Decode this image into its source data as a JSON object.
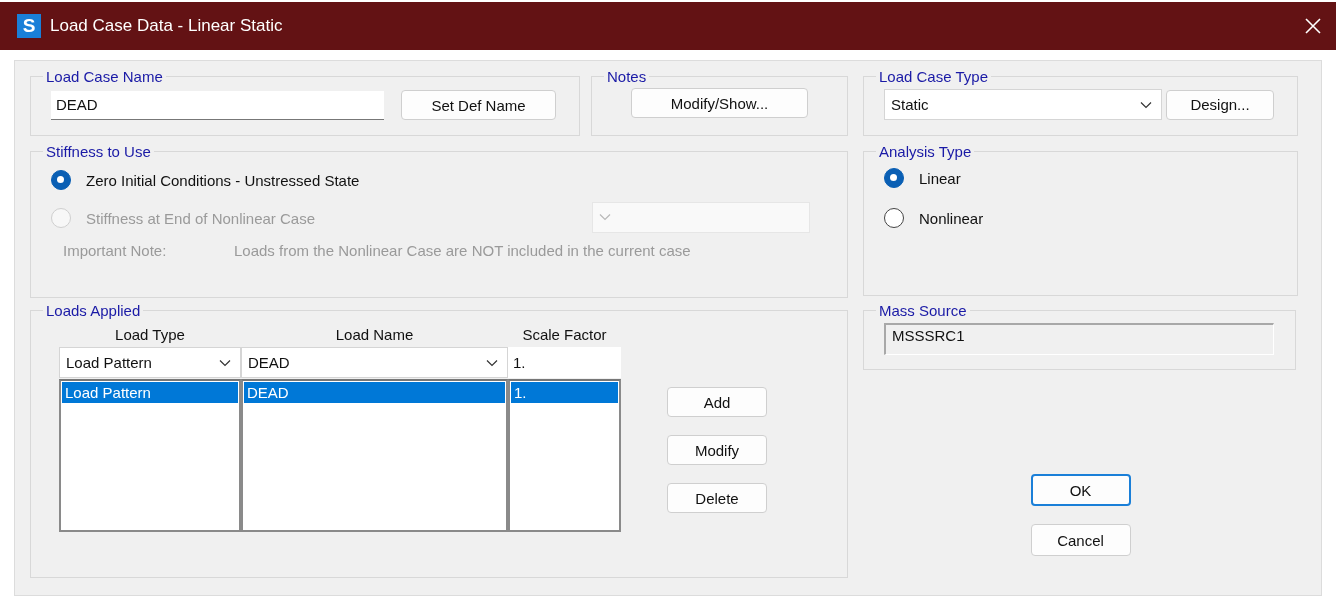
{
  "window": {
    "icon_letter": "S",
    "title": "Load Case Data - Linear Static"
  },
  "load_case_name": {
    "label": "Load Case Name",
    "value": "DEAD",
    "button": "Set Def Name"
  },
  "notes": {
    "label": "Notes",
    "button": "Modify/Show..."
  },
  "load_case_type": {
    "label": "Load Case Type",
    "value": "Static",
    "button": "Design..."
  },
  "stiffness": {
    "label": "Stiffness to Use",
    "options": [
      {
        "label": "Zero Initial Conditions - Unstressed State",
        "selected": true,
        "disabled": false
      },
      {
        "label": "Stiffness at End of Nonlinear Case",
        "selected": false,
        "disabled": true
      }
    ],
    "case_dropdown": {
      "disabled": true
    },
    "note_label": "Important Note:",
    "note": "Loads from the Nonlinear Case are NOT included in the current case"
  },
  "analysis_type": {
    "label": "Analysis Type",
    "options": [
      {
        "label": "Linear",
        "selected": true
      },
      {
        "label": "Nonlinear",
        "selected": false
      }
    ]
  },
  "loads_applied": {
    "label": "Loads Applied",
    "columns": [
      "Load Type",
      "Load Name",
      "Scale Factor"
    ],
    "inputs": [
      {
        "kind": "dropdown",
        "value": "Load Pattern"
      },
      {
        "kind": "dropdown",
        "value": "DEAD"
      },
      {
        "kind": "text",
        "value": "1."
      }
    ],
    "rows": [
      {
        "cells": [
          "Load Pattern",
          "DEAD",
          "1."
        ],
        "selected": true
      }
    ],
    "buttons": [
      "Add",
      "Modify",
      "Delete"
    ]
  },
  "mass_source": {
    "label": "Mass Source",
    "value": "MSSSRC1"
  },
  "buttons": [
    {
      "label": "OK",
      "default": true
    },
    {
      "label": "Cancel",
      "default": false
    }
  ]
}
